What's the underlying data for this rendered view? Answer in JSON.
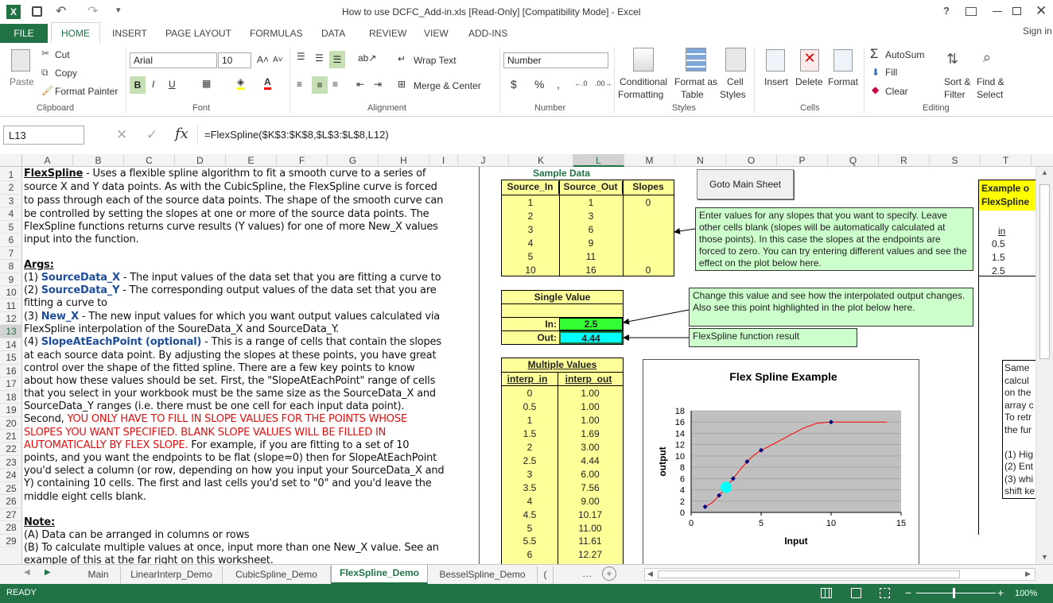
{
  "window": {
    "title": "How to use DCFC_Add-in.xls  [Read-Only]  [Compatibility Mode] - Excel",
    "help": "?",
    "signin": "Sign in"
  },
  "tabs": [
    "FILE",
    "HOME",
    "INSERT",
    "PAGE LAYOUT",
    "FORMULAS",
    "DATA",
    "REVIEW",
    "VIEW",
    "ADD-INS"
  ],
  "ribbon": {
    "clipboard": {
      "paste": "Paste",
      "cut": "Cut",
      "copy": "Copy",
      "painter": "Format Painter",
      "label": "Clipboard"
    },
    "font": {
      "name": "Arial",
      "size": "10",
      "label": "Font"
    },
    "alignment": {
      "wrap": "Wrap Text",
      "merge": "Merge & Center",
      "label": "Alignment"
    },
    "number": {
      "format": "Number",
      "label": "Number"
    },
    "styles": {
      "cond1": "Conditional",
      "cond2": "Formatting",
      "fmt1": "Format as",
      "fmt2": "Table",
      "cell1": "Cell",
      "cell2": "Styles",
      "label": "Styles"
    },
    "cells": {
      "insert": "Insert",
      "delete": "Delete",
      "format": "Format",
      "label": "Cells"
    },
    "editing": {
      "autosum": "AutoSum",
      "fill": "Fill",
      "clear": "Clear",
      "sort1": "Sort &",
      "sort2": "Filter",
      "find1": "Find &",
      "find2": "Select",
      "label": "Editing"
    }
  },
  "formula_bar": {
    "name_box": "L13",
    "formula": "=FlexSpline($K$3:$K$8,$L$3:$L$8,L12)"
  },
  "columns": [
    "A",
    "B",
    "C",
    "D",
    "E",
    "F",
    "G",
    "H",
    "I",
    "J",
    "K",
    "L",
    "M",
    "N",
    "O",
    "P",
    "Q",
    "R",
    "S",
    "T"
  ],
  "rows": [
    "1",
    "2",
    "3",
    "4",
    "5",
    "6",
    "7",
    "8",
    "9",
    "10",
    "11",
    "12",
    "13",
    "14",
    "15",
    "16",
    "17",
    "18",
    "19",
    "20",
    "21",
    "22",
    "23",
    "24",
    "25",
    "26",
    "27",
    "28",
    "29"
  ],
  "text": {
    "r1a": "FlexSpline",
    "r1b": " - Uses a flexible spline algorithm to fit a smooth curve to a series of",
    "r2": "source X and Y data points.  As with the CubicSpline, the FlexSpline curve is forced",
    "r3": "to pass through each of the source data points.  The shape of the smooth curve can",
    "r4": "be controlled by setting the slopes at one or more of the source data points.  The",
    "r5": "FlexSpline functions returns curve results (Y values) for one of more New_X values",
    "r6": "input into the function.",
    "r8": "Args:",
    "r9a": "(1) ",
    "r9b": "SourceData_X",
    "r9c": " - The input values of the data set that you are fitting a curve to",
    "r10a": "(2) ",
    "r10b": "SourceData_Y",
    "r10c": " - The corresponding output values of the data set that you are",
    "r11": "fitting a curve to",
    "r12a": "(3) ",
    "r12b": "New_X",
    "r12c": " - The new input values for which you want output values calculated via",
    "r13": "FlexSpline interpolation of the SoureData_X and SourceData_Y.",
    "r14a": "(4) ",
    "r14b": "SlopeAtEachPoint (optional)",
    "r14c": " - This is a range of cells that contain the slopes",
    "r15": "at each source data point.  By adjusting the slopes at these points, you have great",
    "r16": "control over the shape of the fitted spline.  There are a few key points to know",
    "r17": "about how these values should be set.  First, the \"SlopeAtEachPoint\" range of cells",
    "r18": "that you select in your workbook must be the same size as the SourceData_X and",
    "r19": "SourceData_Y ranges (i.e. there must be one cell for each input data point).",
    "r20a": "Second, ",
    "r20b": "YOU ONLY HAVE TO FILL IN SLOPE VALUES FOR THE POINTS WHOSE",
    "r21": "SLOPES YOU WANT SPECIFIED.  BLANK SLOPE VALUES WILL BE FILLED IN",
    "r22a": "AUTOMATICALLY BY FLEX SLOPE.",
    "r22b": "  For example, if you are fitting to a set of 10",
    "r23": "points, and you want the endpoints to be flat (slope=0) then for SlopeAtEachPoint",
    "r24": "you'd select a column (or row, depending on how you input your SourceData_X and",
    "r25": "Y) containing 10 cells.  The first and last cells you'd set to \"0\" and you'd leave the",
    "r26": "middle eight cells blank.",
    "r28": "Note:",
    "r29": "(A) Data can be arranged in columns or rows",
    "r30": "(B) To calculate multiple values at once, input more than one New_X value.  See an",
    "r31": "example of this at the far right on this worksheet."
  },
  "sample": {
    "title": "Sample Data",
    "headers": [
      "Source_In",
      "Source_Out",
      "Slopes"
    ],
    "rows": [
      [
        "1",
        "1",
        "0"
      ],
      [
        "2",
        "3",
        ""
      ],
      [
        "3",
        "6",
        ""
      ],
      [
        "4",
        "9",
        ""
      ],
      [
        "5",
        "11",
        ""
      ],
      [
        "10",
        "16",
        "0"
      ]
    ]
  },
  "goto_button": "Goto Main Sheet",
  "note1": "Enter values for any slopes that you want to specify. Leave other cells blank (slopes will be automatically calculated at those points). In this case the slopes at the endpoints are forced to zero.  You can try entering different values and see the effect on the plot below here.",
  "note2": "Change this value and see how the interpolated output changes.  Also see this point highlighted in the plot below here.",
  "note3": "FlexSpline function result",
  "single": {
    "title": "Single Value",
    "in_label": "In:",
    "in_value": "2.5",
    "out_label": "Out:",
    "out_value": "4.44"
  },
  "multiple": {
    "title": "Multiple Values",
    "headers": [
      "interp_in",
      "interp_out"
    ],
    "rows": [
      [
        "0",
        "1.00"
      ],
      [
        "0.5",
        "1.00"
      ],
      [
        "1",
        "1.00"
      ],
      [
        "1.5",
        "1.69"
      ],
      [
        "2",
        "3.00"
      ],
      [
        "2.5",
        "4.44"
      ],
      [
        "3",
        "6.00"
      ],
      [
        "3.5",
        "7.56"
      ],
      [
        "4",
        "9.00"
      ],
      [
        "4.5",
        "10.17"
      ],
      [
        "5",
        "11.00"
      ],
      [
        "5.5",
        "11.61"
      ],
      [
        "6",
        "12.27"
      ]
    ]
  },
  "example_box": {
    "title1": "Example o",
    "title2": "FlexSpline",
    "col": "in",
    "vals": [
      "0.5",
      "1.5",
      "2.5"
    ]
  },
  "side_text": [
    "Same",
    "calcul",
    "on the",
    "array c",
    "To retr",
    "the fur",
    "",
    "(1) Hig",
    "(2) Ent",
    "(3) whi",
    "shift ke"
  ],
  "chart_data": {
    "type": "scatter",
    "title": "Flex Spline Example",
    "xlabel": "Input",
    "ylabel": "output",
    "xlim": [
      0,
      15
    ],
    "ylim": [
      0,
      18
    ],
    "xticks": [
      "0",
      "5",
      "10",
      "15"
    ],
    "yticks": [
      "0",
      "2",
      "4",
      "6",
      "8",
      "10",
      "12",
      "14",
      "16",
      "18"
    ],
    "grid": true,
    "series": [
      {
        "points": [
          [
            1,
            1
          ],
          [
            2,
            3
          ],
          [
            3,
            6
          ],
          [
            4,
            9
          ],
          [
            5,
            11
          ],
          [
            10,
            16
          ]
        ],
        "color": "#000080"
      },
      {
        "curve": [
          [
            1,
            1
          ],
          [
            1.5,
            1.69
          ],
          [
            2,
            3
          ],
          [
            2.5,
            4.44
          ],
          [
            3,
            6
          ],
          [
            3.5,
            7.56
          ],
          [
            4,
            9
          ],
          [
            4.5,
            10.17
          ],
          [
            5,
            11
          ],
          [
            5.5,
            11.61
          ],
          [
            6,
            12.27
          ],
          [
            7,
            13.6
          ],
          [
            8,
            14.9
          ],
          [
            9,
            15.8
          ],
          [
            10,
            16
          ],
          [
            11,
            16
          ],
          [
            12,
            16
          ],
          [
            13,
            16
          ],
          [
            14,
            16
          ]
        ],
        "color": "#ff0000"
      },
      {
        "highlight": [
          [
            2.5,
            4.44
          ]
        ],
        "color": "#00ffff"
      }
    ]
  },
  "sheets": [
    "Main",
    "LinearInterp_Demo",
    "CubicSpline_Demo",
    "FlexSpline_Demo",
    "BesselSpline_Demo",
    "("
  ],
  "active_sheet": "FlexSpline_Demo",
  "status": {
    "mode": "READY",
    "zoom": "100%"
  },
  "colors": {
    "excel_green": "#217346",
    "yellow": "#ffff99",
    "green_note": "#ccffcc",
    "cell_green": "#33ff33",
    "cell_cyan": "#00ffff",
    "sample_title": "#217346"
  }
}
